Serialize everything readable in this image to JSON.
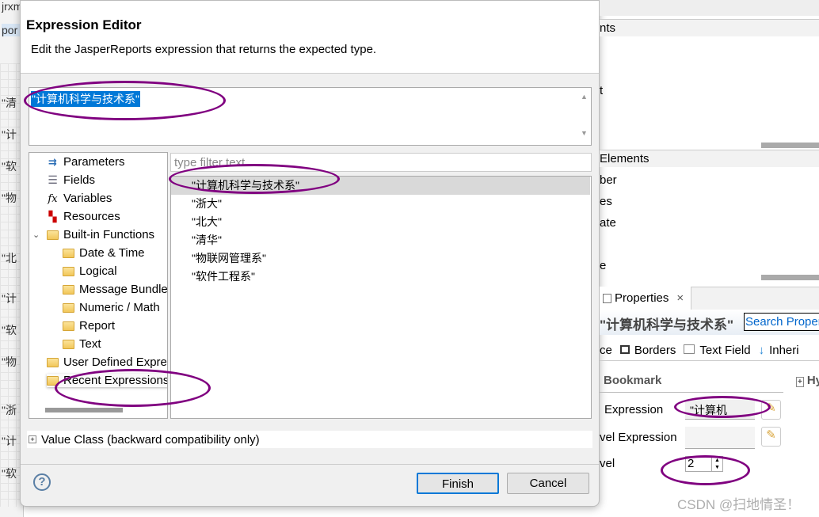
{
  "background": {
    "left_top": "jrxm",
    "left_tab": "por",
    "left_labels": [
      "\"清",
      "\"计",
      "\"软",
      "\"物",
      "\"北",
      "\"计",
      "\"软",
      "\"物",
      "\"浙",
      "\"计",
      "\"软"
    ]
  },
  "dialog": {
    "title": "Expression Editor",
    "description": "Edit the JasperReports expression that returns the expected type.",
    "expression": "\"计算机科学与技术系\"",
    "tree": [
      {
        "label": "Parameters",
        "icon": "parameters-icon",
        "indent": 0
      },
      {
        "label": "Fields",
        "icon": "database-icon",
        "indent": 0
      },
      {
        "label": "Variables",
        "icon": "fx-icon",
        "indent": 0
      },
      {
        "label": "Resources",
        "icon": "flags-icon",
        "indent": 0
      },
      {
        "label": "Built-in Functions",
        "icon": "folder-icon",
        "indent": 0,
        "expanded": true
      },
      {
        "label": "Date & Time",
        "icon": "folder-icon",
        "indent": 1
      },
      {
        "label": "Logical",
        "icon": "folder-icon",
        "indent": 1
      },
      {
        "label": "Message Bundle",
        "icon": "folder-icon",
        "indent": 1
      },
      {
        "label": "Numeric / Math",
        "icon": "folder-icon",
        "indent": 1
      },
      {
        "label": "Report",
        "icon": "folder-icon",
        "indent": 1
      },
      {
        "label": "Text",
        "icon": "folder-icon",
        "indent": 1
      },
      {
        "label": "User Defined Expressions",
        "icon": "folder-icon",
        "indent": 0
      },
      {
        "label": "Recent Expressions",
        "icon": "folder-icon",
        "indent": 0,
        "selected": true
      }
    ],
    "filter_placeholder": "type filter text",
    "list": [
      "\"计算机科学与技术系\"",
      "\"浙大\"",
      "\"北大\"",
      "\"清华\"",
      "\"物联网管理系\"",
      "\"软件工程系\""
    ],
    "selected_list_index": 0,
    "value_class": "Value Class (backward compatibility only)",
    "finish": "Finish",
    "cancel": "Cancel"
  },
  "right": {
    "sec1": "nts",
    "sec1_item": "t",
    "sec2": "Elements",
    "sec2_items": [
      "ber",
      "es",
      "ate",
      "e"
    ],
    "properties_tab": "Properties",
    "element_title": "\"计算机科学与技术系\"",
    "search_placeholder": "Search Properties",
    "tabs": [
      "ce",
      "Borders",
      "Text Field",
      "Inheri"
    ],
    "bookmark": "Bookmark",
    "hy": "Hy",
    "expr_label": "Expression",
    "expr_value": "\"计算机",
    "level_expr_label": "vel Expression",
    "level_label": "vel",
    "level_value": "2"
  },
  "watermark": "CSDN @扫地情圣！",
  "colors": {
    "selection": "#0078d7",
    "annotation": "#800080",
    "link": "#0066cc"
  }
}
